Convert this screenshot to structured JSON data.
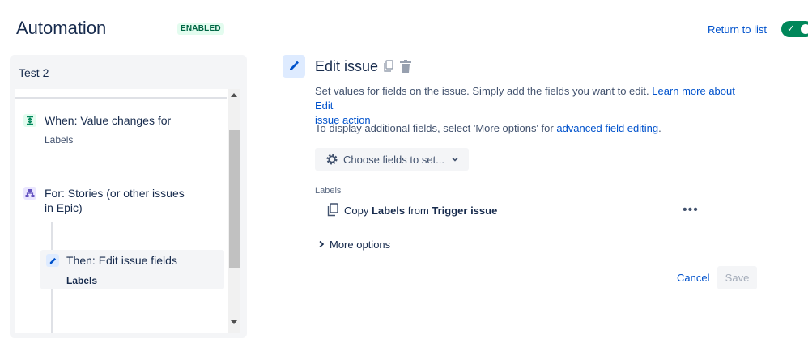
{
  "header": {
    "title": "Automation",
    "status_badge": "ENABLED",
    "return_link": "Return to list",
    "toggle_on": true
  },
  "rule": {
    "name": "Test 2",
    "nodes": [
      {
        "type": "trigger",
        "title": "When: Value changes for",
        "subtitle": "Labels",
        "icon": "trigger-icon"
      },
      {
        "type": "branch",
        "title_line1": "For: Stories (or other issues",
        "title_line2": "in Epic)",
        "icon": "branch-icon"
      },
      {
        "type": "action",
        "title": "Then: Edit issue fields",
        "subtitle": "Labels",
        "icon": "pencil-icon"
      }
    ]
  },
  "panel": {
    "title": "Edit issue",
    "desc1_text": "Set values for fields on the issue. Simply add the fields you want to edit. ",
    "desc1_link_line1": "Learn more about Edit",
    "desc1_link_line2": "issue action",
    "desc2_text": "To display additional fields, select 'More options' for ",
    "desc2_link": "advanced field editing",
    "desc2_end": ".",
    "choose_fields": "Choose fields to set...",
    "field_label": "Labels",
    "copy_row": {
      "prefix": "Copy ",
      "field": "Labels",
      "middle": " from ",
      "source": "Trigger issue"
    },
    "more_dots": "•••",
    "more_options": "More options",
    "cancel": "Cancel",
    "save": "Save"
  },
  "colors": {
    "accent": "#0052cc",
    "toggle": "#00875a",
    "badge_bg": "#e3fcef",
    "badge_text": "#006644"
  }
}
